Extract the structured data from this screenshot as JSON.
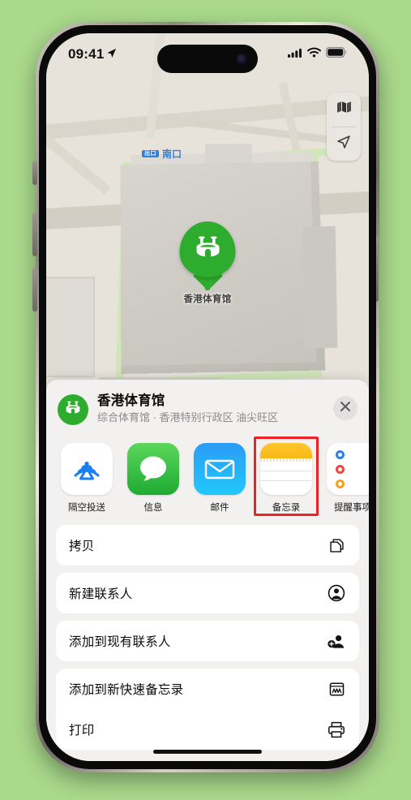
{
  "statusbar": {
    "time": "09:41",
    "location_icon": "location-arrow-icon",
    "cellular_icon": "cellular-bars-icon",
    "wifi_icon": "wifi-icon",
    "battery_icon": "battery-full-icon"
  },
  "map": {
    "exit_badge": "出口",
    "exit_label": "南口",
    "pin_label": "香港体育馆",
    "pin_icon": "stadium-icon",
    "controls": [
      {
        "name": "map-layers-button",
        "icon": "folded-map-icon"
      },
      {
        "name": "current-location-button",
        "icon": "location-arrow-icon"
      }
    ]
  },
  "sheet": {
    "badge_icon": "stadium-icon",
    "title": "香港体育馆",
    "subtitle": "综合体育馆 · 香港特别行政区 油尖旺区",
    "close_icon": "close-icon",
    "apps": [
      {
        "label": "隔空投送",
        "icon": "airdrop-icon",
        "highlighted": false
      },
      {
        "label": "信息",
        "icon": "messages-icon",
        "highlighted": false
      },
      {
        "label": "邮件",
        "icon": "mail-icon",
        "highlighted": false
      },
      {
        "label": "备忘录",
        "icon": "notes-icon",
        "highlighted": true
      },
      {
        "label": "提醒事项",
        "icon": "reminders-icon",
        "highlighted": false
      }
    ],
    "actions": [
      {
        "label": "拷贝",
        "icon": "copy-icon"
      },
      {
        "label": "新建联系人",
        "icon": "new-contact-icon"
      },
      {
        "label": "添加到现有联系人",
        "icon": "add-to-contact-icon"
      },
      {
        "label": "添加到新快速备忘录",
        "icon": "quick-note-icon"
      },
      {
        "label": "打印",
        "icon": "printer-icon"
      }
    ]
  },
  "colors": {
    "background": "#a9d98b",
    "accent_green": "#2eac2e",
    "highlight_red": "#ec2227",
    "sheet_bg": "#f2f1f0"
  }
}
